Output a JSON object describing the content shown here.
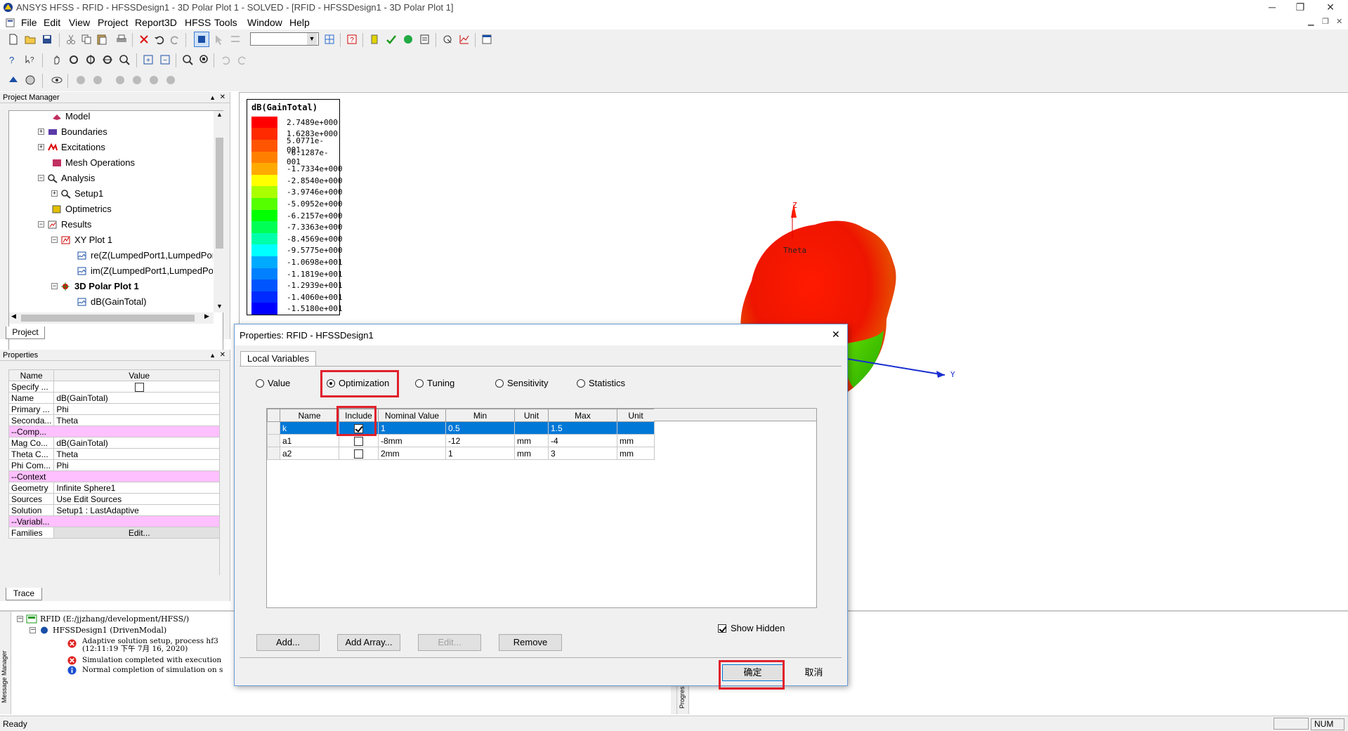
{
  "window": {
    "title": "ANSYS HFSS - RFID - HFSSDesign1 - 3D Polar Plot 1 - SOLVED - [RFID - HFSSDesign1 - 3D Polar Plot 1]",
    "min": "─",
    "restore": "❐",
    "close": "✕"
  },
  "menu": [
    "File",
    "Edit",
    "View",
    "Project",
    "Report3D",
    "HFSS",
    "Tools",
    "Window",
    "Help"
  ],
  "project_manager": {
    "header": "Project Manager",
    "tab": "Project",
    "tree": [
      {
        "label": "Model",
        "icon": "model-icon"
      },
      {
        "label": "Boundaries",
        "icon": "boundaries-icon"
      },
      {
        "label": "Excitations",
        "icon": "excitations-icon"
      },
      {
        "label": "Mesh Operations",
        "icon": "mesh-icon"
      },
      {
        "label": "Analysis",
        "icon": "analysis-icon"
      },
      {
        "label": "Setup1",
        "icon": "setup-icon"
      },
      {
        "label": "Optimetrics",
        "icon": "optimetrics-icon"
      },
      {
        "label": "Results",
        "icon": "results-icon"
      },
      {
        "label": "XY Plot 1",
        "icon": "xy-plot-icon"
      },
      {
        "label": "re(Z(LumpedPort1,LumpedPor",
        "icon": "trace-icon"
      },
      {
        "label": "im(Z(LumpedPort1,LumpedPor",
        "icon": "trace-icon"
      },
      {
        "label": "3D Polar Plot 1",
        "icon": "polar-plot-icon"
      },
      {
        "label": "dB(GainTotal)",
        "icon": "trace-icon"
      }
    ]
  },
  "properties": {
    "header": "Properties",
    "tab": "Trace",
    "col_name": "Name",
    "col_value": "Value",
    "rows": [
      {
        "name": "Specify ...",
        "value": ""
      },
      {
        "name": "Name",
        "value": "dB(GainTotal)"
      },
      {
        "name": "Primary ...",
        "value": "Phi"
      },
      {
        "name": "Seconda...",
        "value": "Theta"
      },
      {
        "name": "--Comp...",
        "value": ""
      },
      {
        "name": "Mag Co...",
        "value": "dB(GainTotal)"
      },
      {
        "name": "Theta C...",
        "value": "Theta"
      },
      {
        "name": "Phi Com...",
        "value": "Phi"
      },
      {
        "name": "--Context",
        "value": ""
      },
      {
        "name": "Geometry",
        "value": "Infinite Sphere1"
      },
      {
        "name": "Sources",
        "value": "Use Edit Sources"
      },
      {
        "name": "Solution",
        "value": "Setup1 : LastAdaptive"
      },
      {
        "name": "--Variabl...",
        "value": ""
      },
      {
        "name": "Families",
        "value": "Edit..."
      }
    ]
  },
  "messages": {
    "side_label": "Message Manager",
    "project": "RFID (E:/jjzhang/development/HFSS/)",
    "design": "HFSSDesign1 (DrivenModal)",
    "lines": [
      {
        "type": "error",
        "text": "Adaptive solution setup, process hf3",
        "sub": "(12:11:19 下午  7月 16, 2020)"
      },
      {
        "type": "error",
        "text": "Simulation completed with execution",
        "sub": ""
      },
      {
        "type": "info",
        "text": "Normal completion of simulation on s",
        "sub": ""
      }
    ],
    "progress_label": "Progress"
  },
  "legend": {
    "title": "dB(GainTotal)",
    "entries": [
      {
        "value": "2.7489e+000",
        "color": "#ff0000"
      },
      {
        "value": "1.6283e+000",
        "color": "#ff2a00"
      },
      {
        "value": "5.0771e-001",
        "color": "#ff5500"
      },
      {
        "value": "-6.1287e-001",
        "color": "#ff8000"
      },
      {
        "value": "-1.7334e+000",
        "color": "#ffaa00"
      },
      {
        "value": "-2.8540e+000",
        "color": "#ffff00"
      },
      {
        "value": "-3.9746e+000",
        "color": "#aaff00"
      },
      {
        "value": "-5.0952e+000",
        "color": "#55ff00"
      },
      {
        "value": "-6.2157e+000",
        "color": "#00ff00"
      },
      {
        "value": "-7.3363e+000",
        "color": "#00ff55"
      },
      {
        "value": "-8.4569e+000",
        "color": "#00ffaa"
      },
      {
        "value": "-9.5775e+000",
        "color": "#00ffff"
      },
      {
        "value": "-1.0698e+001",
        "color": "#00aaff"
      },
      {
        "value": "-1.1819e+001",
        "color": "#0080ff"
      },
      {
        "value": "-1.2939e+001",
        "color": "#0055ff"
      },
      {
        "value": "-1.4060e+001",
        "color": "#002aff"
      },
      {
        "value": "-1.5180e+001",
        "color": "#0000ff"
      }
    ]
  },
  "plot": {
    "axis_z": "Z",
    "axis_y": "Y",
    "theta_label": "Theta"
  },
  "dialog": {
    "title": "Properties: RFID - HFSSDesign1",
    "close": "✕",
    "tab": "Local Variables",
    "radios": [
      {
        "label": "Value",
        "selected": false
      },
      {
        "label": "Optimization",
        "selected": true
      },
      {
        "label": "Tuning",
        "selected": false
      },
      {
        "label": "Sensitivity",
        "selected": false
      },
      {
        "label": "Statistics",
        "selected": false
      }
    ],
    "columns": [
      "Name",
      "Include",
      "Nominal Value",
      "Min",
      "Unit",
      "Max",
      "Unit"
    ],
    "rows": [
      {
        "name": "k",
        "include": true,
        "nominal": "1",
        "min": "0.5",
        "unit_min": "",
        "max": "1.5",
        "unit_max": ""
      },
      {
        "name": "a1",
        "include": false,
        "nominal": "-8mm",
        "min": "-12",
        "unit_min": "mm",
        "max": "-4",
        "unit_max": "mm"
      },
      {
        "name": "a2",
        "include": false,
        "nominal": "2mm",
        "min": "1",
        "unit_min": "mm",
        "max": "3",
        "unit_max": "mm"
      }
    ],
    "show_hidden": "Show Hidden",
    "buttons": {
      "add": "Add...",
      "add_array": "Add Array...",
      "edit": "Edit...",
      "remove": "Remove"
    },
    "ok": "确定",
    "cancel": "取消"
  },
  "status": {
    "text": "Ready",
    "num": "NUM"
  }
}
